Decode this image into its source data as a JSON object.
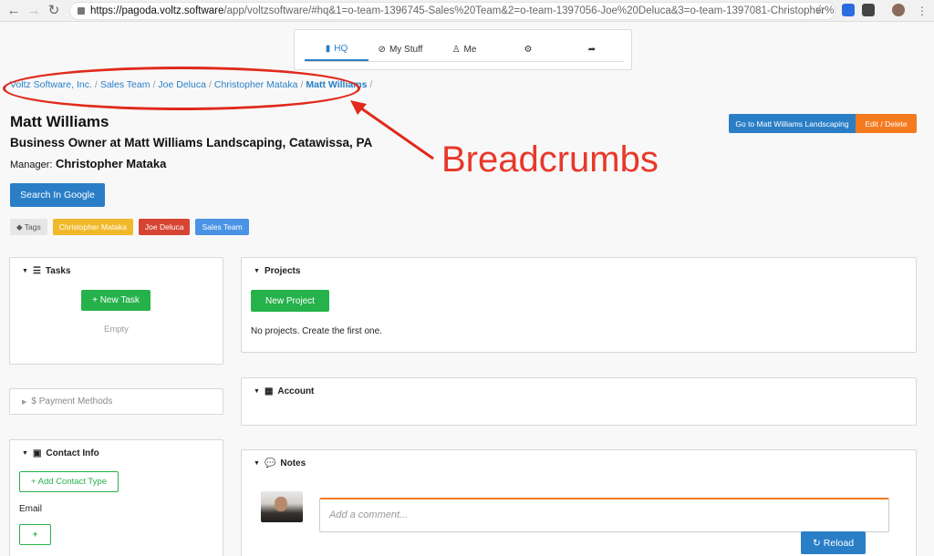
{
  "browser": {
    "url_host": "https://pagoda.voltz.software",
    "url_path": "/app/voltzsoftware/#hq&1=o-team-1396745-Sales%20Team&2=o-team-1397056-Joe%20Deluca&3=o-team-1397081-Christopher%20Ma..."
  },
  "topnav": {
    "tabs": [
      {
        "label": "HQ",
        "icon": "building-icon"
      },
      {
        "label": "My Stuff",
        "icon": "compass-icon"
      },
      {
        "label": "Me",
        "icon": "user-icon"
      },
      {
        "label": "",
        "icon": "cogs-icon"
      },
      {
        "label": "",
        "icon": "share-icon"
      }
    ]
  },
  "breadcrumb": {
    "items": [
      "Voltz Software, Inc.",
      "Sales Team",
      "Joe Deluca",
      "Christopher Mataka",
      "Matt Williams"
    ],
    "separator": "/"
  },
  "annotation": {
    "text": "Breadcrumbs",
    "color": "#e02a1c"
  },
  "contact": {
    "name": "Matt Williams",
    "title": "Business Owner at Matt Williams Landscaping, Catawissa, PA",
    "manager_label": "Manager:",
    "manager_name": "Christopher Mataka"
  },
  "actions": {
    "search_google": "Search In Google",
    "goto": "Go to Matt Williams Landscaping",
    "edit_delete": "Edit / Delete"
  },
  "tags": {
    "label": "Tags",
    "items": [
      {
        "text": "Christopher Mataka",
        "color": "#f0b92a"
      },
      {
        "text": "Joe Deluca",
        "color": "#d64533"
      },
      {
        "text": "Sales Team",
        "color": "#4b93e4"
      }
    ]
  },
  "panels": {
    "tasks": {
      "title": "Tasks",
      "button": "+ New Task",
      "empty": "Empty"
    },
    "projects": {
      "title": "Projects",
      "button": "New Project",
      "empty": "No projects. Create the first one."
    },
    "payment": {
      "title": "$ Payment Methods"
    },
    "account": {
      "title": "Account"
    },
    "contact_info": {
      "title": "Contact Info",
      "button": "+ Add Contact Type",
      "email_label": "Email",
      "add_button": "+"
    },
    "notes": {
      "title": "Notes",
      "placeholder": "Add a comment...",
      "reload": "Reload"
    }
  },
  "colors": {
    "primary": "#2a7ec6",
    "success": "#26b24b",
    "warning": "#f47a20"
  }
}
